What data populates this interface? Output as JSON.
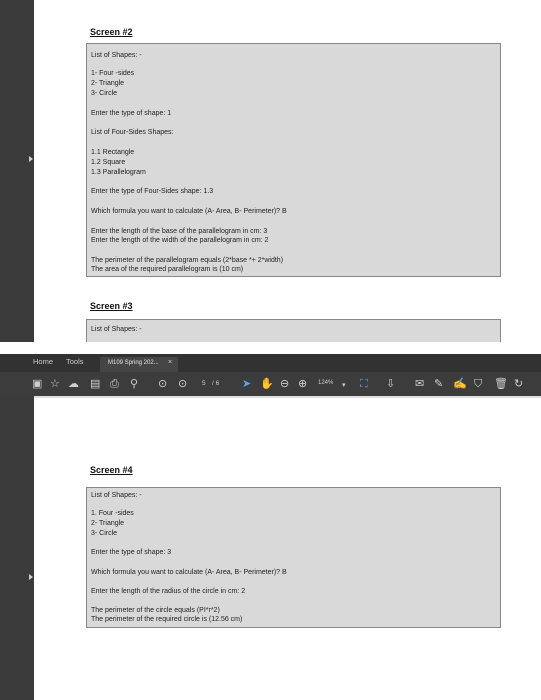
{
  "screen2": {
    "heading": "Screen #2",
    "lines": [
      "List of Shapes: -",
      "1-  Four -sides",
      "2-  Triangle",
      "3-  Circle",
      "Enter the type of shape: 1",
      "List of Four-Sides Shapes:",
      "1.1 Rectangle",
      "1.2 Square",
      "1.3 Parallelogram",
      "Enter the type of Four-Sides shape: 1.3",
      "Which formula you want to calculate (A- Area, B- Perimeter)? B",
      "Enter the length of the base of the parallelogram in cm: 3",
      "Enter the length of the width of the parallelogram in cm: 2",
      "The perimeter of the parallelogram equals (2*base *+ 2*width)",
      "The area of the required parallelogram is (10 cm)"
    ]
  },
  "screen3": {
    "heading": "Screen #3",
    "lines": [
      "List of Shapes: -"
    ]
  },
  "toolbar": {
    "menu_home": "Home",
    "menu_tools": "Tools",
    "doc_tab": "M109 Spring 202...",
    "doc_tab_close": "×",
    "page_current": "5",
    "page_total": "/ 6",
    "zoom": "124%"
  },
  "screen4": {
    "heading": "Screen #4",
    "lines": [
      "List of Shapes: -",
      "1.  Four -sides",
      "2-  Triangle",
      "3-  Circle",
      "Enter the type of shape: 3",
      "Which formula you want to calculate (A- Area, B- Perimeter)? B",
      "Enter the length of the radius of the circle in cm: 2",
      "The perimeter of the circle equals (PI*r*2)",
      "The perimeter of the required circle is (12.56 cm)"
    ]
  }
}
